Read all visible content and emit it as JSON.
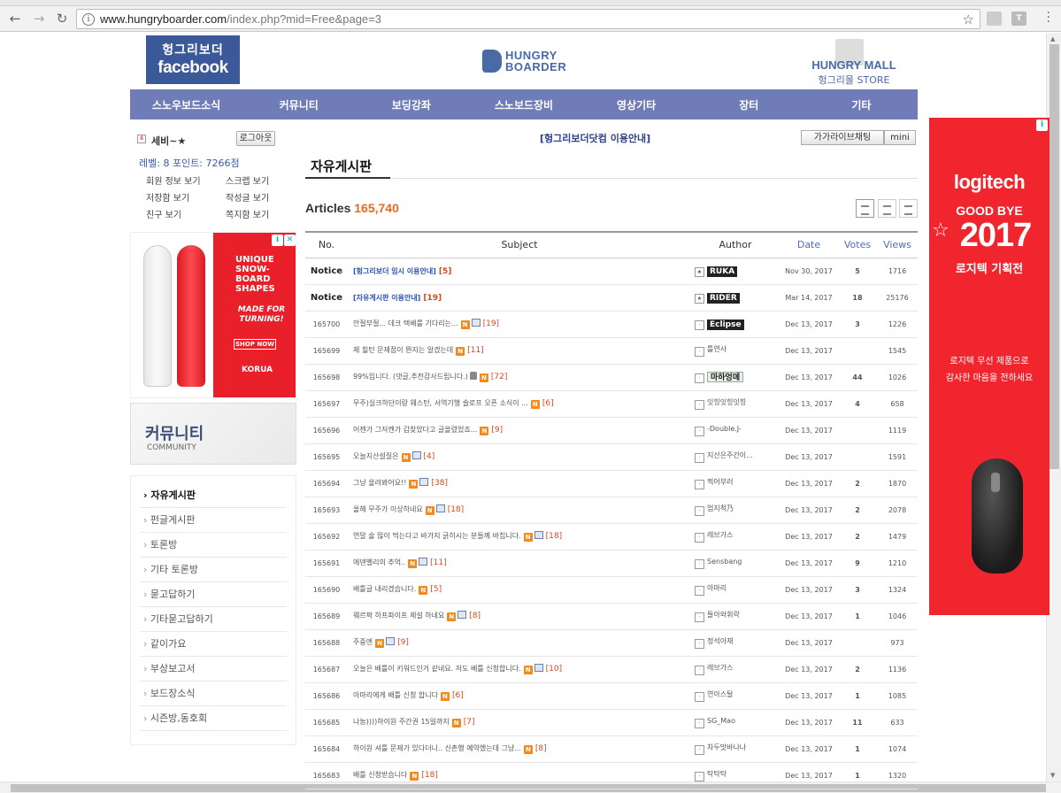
{
  "browser": {
    "url_host": "www.hungryboarder.com",
    "url_path": "/index.php?mid=Free&page=3"
  },
  "header": {
    "fb_line1": "헝그리보더",
    "fb_line2": "facebook",
    "hb_line1": "HUNGRY",
    "hb_line2": "BOARDER",
    "mall_line1": "HUNGRY MALL",
    "mall_line2": "헝그리몰 STORE"
  },
  "nav": [
    "스노우보드소식",
    "커뮤니티",
    "보딩강좌",
    "스노보드장비",
    "영상기타",
    "장터",
    "기타"
  ],
  "login": {
    "nickname": "세비~★",
    "logout": "로그아웃",
    "stats": "레벨: 8  포인트: 7266점",
    "links": [
      "회원 정보 보기",
      "스크랩 보기",
      "저장함 보기",
      "작성글 보기",
      "친구 보기",
      "쪽지함 보기"
    ]
  },
  "ad_left": {
    "headline": "UNIQUE SNOW- BOARD SHAPES",
    "sub": "MADE FOR TURNING!",
    "cta": "SHOP NOW",
    "brand": "KORUA"
  },
  "community": {
    "title": "커뮤니티",
    "sub": "COMMUNITY"
  },
  "sidemenu": [
    "자유게시판",
    "펀글게시판",
    "토론방",
    "기타 토론방",
    "묻고답하기",
    "기타묻고답하기",
    "같이가요",
    "부상보고서",
    "보드장소식",
    "시즌방,동호회"
  ],
  "main": {
    "notice_link": "[헝그리보더닷컴 이용안내]",
    "chat": "가가라이브채팅",
    "mini": "mini",
    "board_title": "자유게시판",
    "articles_label": "Articles",
    "articles_count": "165,740"
  },
  "table": {
    "headers": {
      "no": "No.",
      "subject": "Subject",
      "author": "Author",
      "date": "Date",
      "votes": "Votes",
      "views": "Views"
    },
    "rows": [
      {
        "no": "Notice",
        "subject": "[헝그리보더 임시 이용안내]",
        "comments": "[5]",
        "author": "RUKA",
        "date": "Nov 30, 2017",
        "votes": "5",
        "views": "1716"
      },
      {
        "no": "Notice",
        "subject": "[자유게시판 이용안내]",
        "comments": "[19]",
        "author": "RIDER",
        "date": "Mar 14, 2017",
        "votes": "18",
        "views": "25176"
      },
      {
        "no": "165700",
        "subject": "안절부절... 데크 택배를 기다리는...",
        "comments": "[19]",
        "author": "Eclipse",
        "date": "Dec 13, 2017",
        "votes": "3",
        "views": "1226"
      },
      {
        "no": "165699",
        "subject": "제 힐턴 문제점이 뭔지는 알겠는데",
        "comments": "[11]",
        "author": "틀연사",
        "date": "Dec 13, 2017",
        "votes": "",
        "views": "1545"
      },
      {
        "no": "165698",
        "subject": "99%입니다. (댓글,추천감사드립니다.)",
        "comments": "[72]",
        "author": "마하엉뎨",
        "date": "Dec 13, 2017",
        "votes": "44",
        "views": "1026"
      },
      {
        "no": "165697",
        "subject": "무주)실크하단이랑 웨스턴, 서역기행 슬로프 오픈 소식이 ...",
        "comments": "[6]",
        "author": "잇힝잇힝잇힝",
        "date": "Dec 13, 2017",
        "votes": "4",
        "views": "658"
      },
      {
        "no": "165696",
        "subject": "어젠가 그저껜가 갑찾았다고 글올렸었죠...",
        "comments": "[9]",
        "author": "-Double.J-",
        "date": "Dec 13, 2017",
        "votes": "",
        "views": "1119"
      },
      {
        "no": "165695",
        "subject": "오늘지산설질은",
        "comments": "[4]",
        "author": "지산은주간이...",
        "date": "Dec 13, 2017",
        "votes": "",
        "views": "1591"
      },
      {
        "no": "165694",
        "subject": "그냥 올려봐어요!!",
        "comments": "[38]",
        "author": "찍어부러",
        "date": "Dec 13, 2017",
        "votes": "2",
        "views": "1870"
      },
      {
        "no": "165693",
        "subject": "올해 무주가 이상하네요",
        "comments": "[18]",
        "author": "엄지척乃",
        "date": "Dec 13, 2017",
        "votes": "2",
        "views": "2078"
      },
      {
        "no": "165692",
        "subject": "연말 술 많이 먹는다고 바가지 긁히시는 분들께 바칩니다.",
        "comments": "[18]",
        "author": "레브가스",
        "date": "Dec 13, 2017",
        "votes": "2",
        "views": "1479"
      },
      {
        "no": "165691",
        "subject": "에덴벨리의 추억..",
        "comments": "[11]",
        "author": "Sensbang",
        "date": "Dec 13, 2017",
        "votes": "9",
        "views": "1210"
      },
      {
        "no": "165690",
        "subject": "배틀글 내리겠습니다.",
        "comments": "[5]",
        "author": "아마리",
        "date": "Dec 13, 2017",
        "votes": "3",
        "views": "1324"
      },
      {
        "no": "165689",
        "subject": "웨르팍 하프파이프 제설 하네요",
        "comments": "[8]",
        "author": "들아와휘락",
        "date": "Dec 13, 2017",
        "votes": "1",
        "views": "1046"
      },
      {
        "no": "165688",
        "subject": "주중엔",
        "comments": "[9]",
        "author": "정석아재",
        "date": "Dec 13, 2017",
        "votes": "",
        "views": "973"
      },
      {
        "no": "165687",
        "subject": "오늘은 베틀이 키워드인거 같네요. 저도 베틀 신청합니다.",
        "comments": "[10]",
        "author": "레브가스",
        "date": "Dec 13, 2017",
        "votes": "2",
        "views": "1136"
      },
      {
        "no": "165686",
        "subject": "아마리에게 배틀 신청 합니다",
        "comments": "[6]",
        "author": "연아스탈",
        "date": "Dec 13, 2017",
        "votes": "1",
        "views": "1085"
      },
      {
        "no": "165685",
        "subject": "나눔))))하이원 주간권 15일까지",
        "comments": "[7]",
        "author": "SG_Mao",
        "date": "Dec 13, 2017",
        "votes": "11",
        "views": "633"
      },
      {
        "no": "165684",
        "subject": "하이원 셔틀 문제가 있다더니.. 신촌행 예약했는데 그냥...",
        "comments": "[8]",
        "author": "차두맛바나나",
        "date": "Dec 13, 2017",
        "votes": "1",
        "views": "1074"
      },
      {
        "no": "165683",
        "subject": "배틀 신청받습니다",
        "comments": "[18]",
        "author": "탁탁탁",
        "date": "Dec 13, 2017",
        "votes": "1",
        "views": "1320"
      }
    ]
  },
  "ad_right": {
    "logo": "logitech",
    "headline1": "GOOD BYE",
    "headline2": "2017",
    "promo": "로지텍 기획전",
    "sub1": "로지텍 무선 제품으로",
    "sub2": "감사한 마음을 전하세요"
  }
}
